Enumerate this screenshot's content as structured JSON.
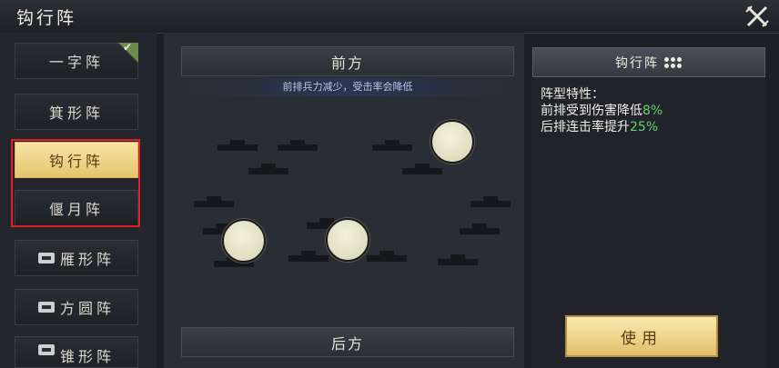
{
  "header": {
    "title": "钩行阵"
  },
  "formations": [
    {
      "label": "一字阵",
      "locked": false,
      "checked": true
    },
    {
      "label": "箕形阵",
      "locked": false,
      "checked": false
    },
    {
      "label": "钩行阵",
      "locked": false,
      "checked": false,
      "selected": true
    },
    {
      "label": "偃月阵",
      "locked": false,
      "checked": false
    },
    {
      "label": "雁形阵",
      "locked": true,
      "checked": false
    },
    {
      "label": "方圆阵",
      "locked": true,
      "checked": false
    },
    {
      "label": "锥形阵",
      "locked": true,
      "checked": false
    }
  ],
  "board": {
    "front_label": "前方",
    "back_label": "后方",
    "note": "前排兵力减少，受击率会降低"
  },
  "detail": {
    "title": "钩行阵",
    "traits_heading": "阵型特性：",
    "trait1_text": "前排受到伤害降低",
    "trait1_value": "8%",
    "trait2_text": "后排连击率提升",
    "trait2_value": "25%",
    "use_label": "使用"
  },
  "colors": {
    "accent_gold": "#e6c46d",
    "highlight_green": "#63d46a",
    "frame_red": "#e02020"
  }
}
